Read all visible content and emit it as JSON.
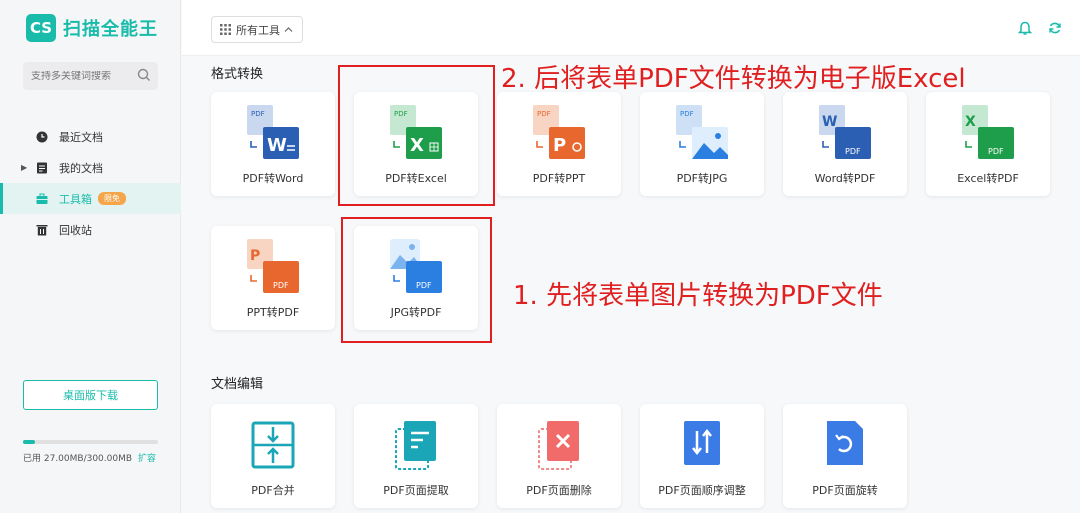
{
  "app": {
    "logo_badge": "CS",
    "logo_text": "扫描全能王"
  },
  "search": {
    "placeholder": "支持多关键词搜索"
  },
  "nav": {
    "items": [
      {
        "label": "最近文档"
      },
      {
        "label": "我的文档"
      },
      {
        "label": "工具箱",
        "badge": "限免"
      },
      {
        "label": "回收站"
      }
    ]
  },
  "download": {
    "label": "桌面版下载"
  },
  "storage": {
    "text": "已用 27.00MB/300.00MB",
    "expand": "扩容",
    "used_fraction": 0.09
  },
  "topbar": {
    "tools_label": "所有工具"
  },
  "sections": {
    "convert_title": "格式转换",
    "edit_title": "文档编辑"
  },
  "convert_tools": [
    {
      "label": "PDF转Word"
    },
    {
      "label": "PDF转Excel"
    },
    {
      "label": "PDF转PPT"
    },
    {
      "label": "PDF转JPG"
    },
    {
      "label": "Word转PDF"
    },
    {
      "label": "Excel转PDF"
    },
    {
      "label": "PPT转PDF"
    },
    {
      "label": "JPG转PDF"
    }
  ],
  "edit_tools": [
    {
      "label": "PDF合并"
    },
    {
      "label": "PDF页面提取"
    },
    {
      "label": "PDF页面删除"
    },
    {
      "label": "PDF页面顺序调整"
    },
    {
      "label": "PDF页面旋转"
    }
  ],
  "icon_text": {
    "pdf": "PDF",
    "word": "W",
    "excel": "X",
    "ppt": "P"
  },
  "annotations": {
    "step2": "2. 后将表单PDF文件转换为电子版Excel",
    "step1": "1. 先将表单图片转换为PDF文件"
  },
  "colors": {
    "brand": "#19bcaa",
    "annotation": "#e02020",
    "word": "#2b5fb4",
    "excel": "#1e9e4a",
    "ppt": "#e8672e",
    "pdf": "#2b5fb4"
  }
}
